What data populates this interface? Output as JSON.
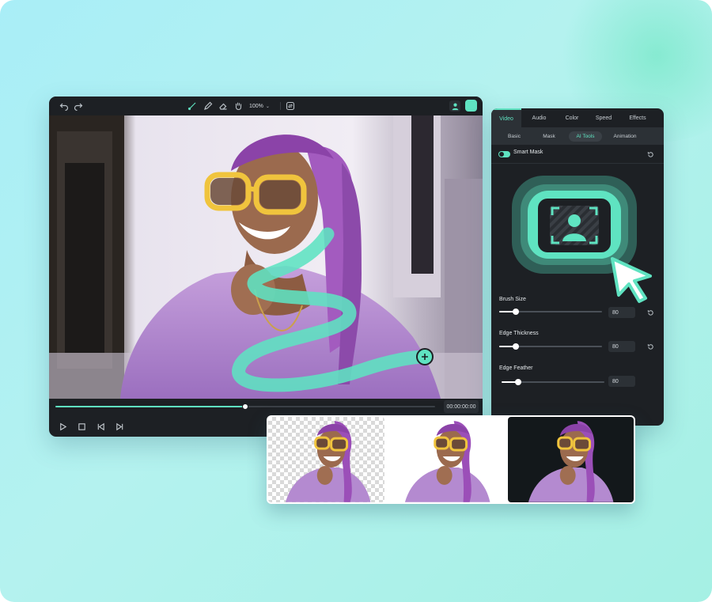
{
  "editor": {
    "toolbar": {
      "zoom_value": "100%",
      "icons": [
        "undo-icon",
        "redo-icon",
        "brush-icon",
        "pen-icon",
        "eraser-icon",
        "hand-icon",
        "swap-icon",
        "avatar-icon"
      ]
    },
    "timecode": "00:00:00:00",
    "progress": 0.5
  },
  "panel": {
    "tabs": [
      "Video",
      "Audio",
      "Color",
      "Speed",
      "Effects"
    ],
    "active_tab": "Video",
    "subtabs": [
      "Basic",
      "Mask",
      "AI Tools",
      "Animation"
    ],
    "active_subtab": "AI Tools",
    "smart_mask": {
      "label": "Smart Mask",
      "enabled": true
    },
    "sliders": [
      {
        "label": "Brush Size",
        "value": "80",
        "level": 0.16
      },
      {
        "label": "Edge Thickness",
        "value": "80",
        "level": 0.16
      },
      {
        "label": "Edge Feather",
        "value": "80",
        "level": 0.16
      }
    ]
  },
  "preview": {
    "thumbnails": [
      "transparent-background",
      "white-background",
      "black-background"
    ]
  },
  "colors": {
    "accent": "#5fe3c1",
    "panel_bg": "#1d2024",
    "background": "#b4f2ef"
  }
}
